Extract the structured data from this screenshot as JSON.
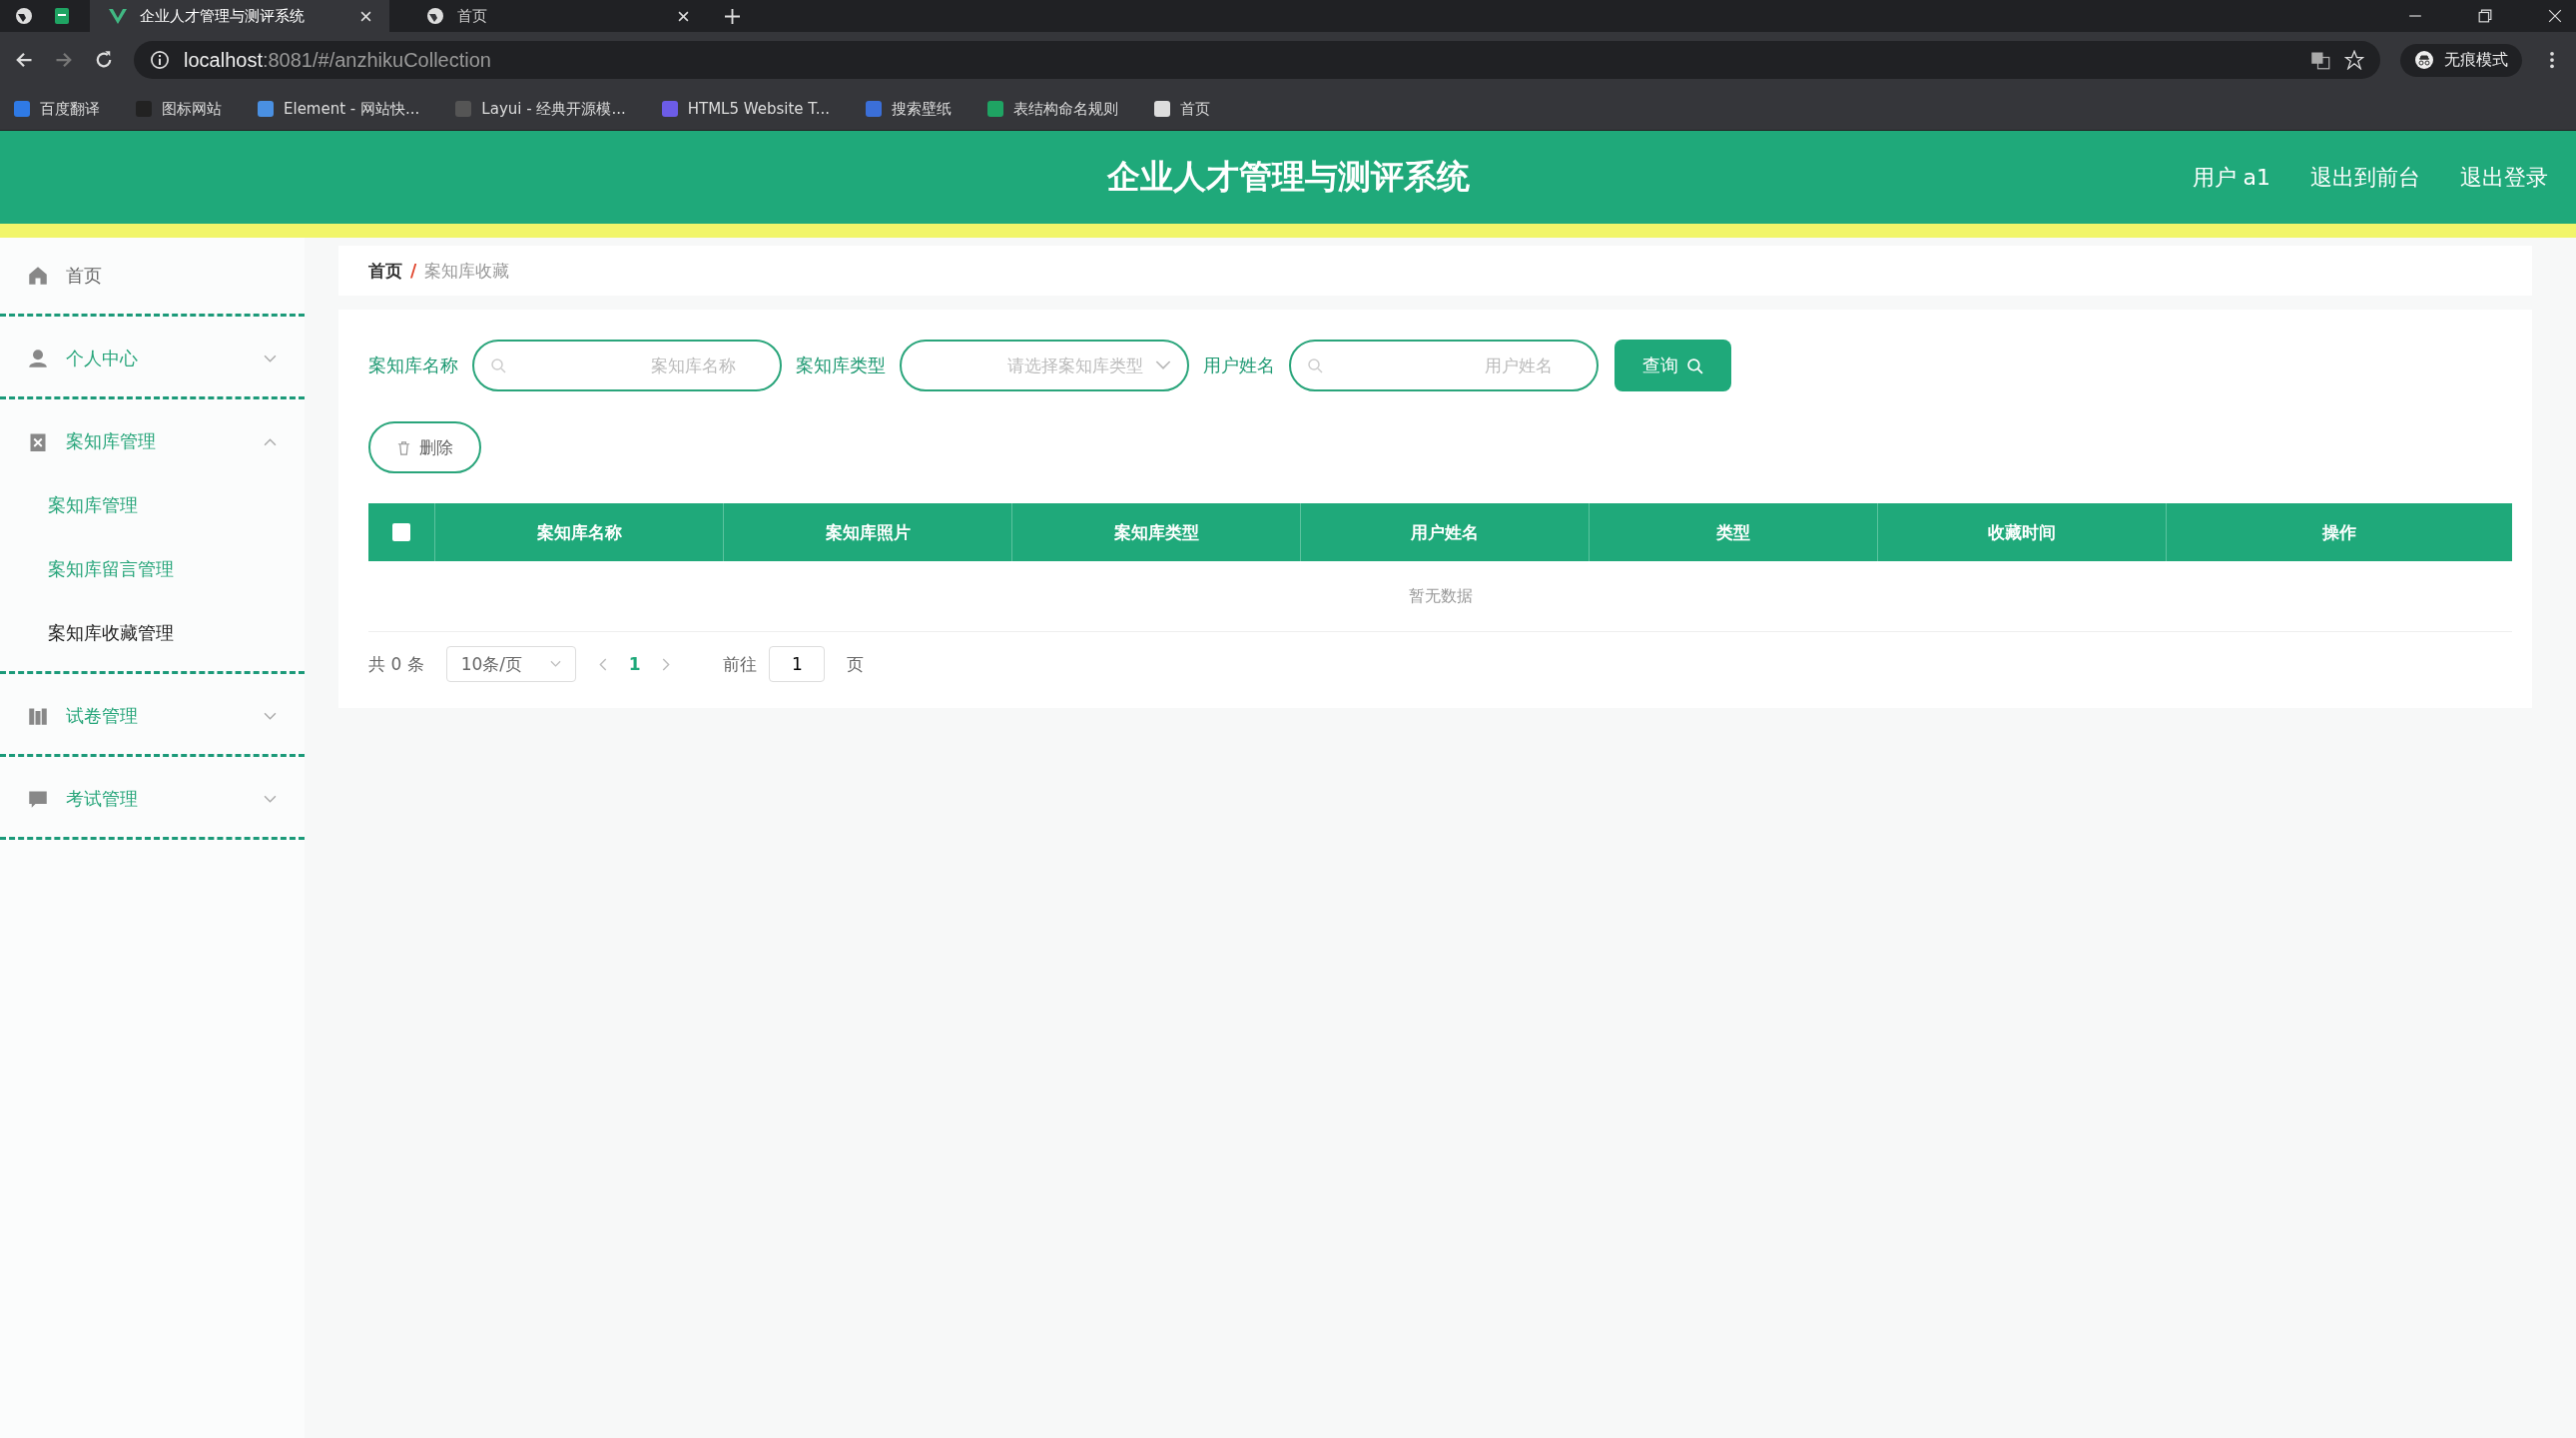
{
  "browser": {
    "tabs": [
      {
        "title": "企业人才管理与测评系统",
        "selected": true,
        "kind": "vue"
      },
      {
        "title": "首页",
        "selected": false,
        "kind": "globe"
      }
    ],
    "url_host": "localhost",
    "url_rest": ":8081/#/anzhikuCollection",
    "profile": "无痕模式",
    "bookmarks": [
      {
        "label": "百度翻译",
        "color": "#2f7ae5"
      },
      {
        "label": "图标网站",
        "color": "#222222"
      },
      {
        "label": "Element - 网站快...",
        "color": "#4a90e2"
      },
      {
        "label": "Layui - 经典开源模...",
        "color": "#555555"
      },
      {
        "label": "HTML5 Website T...",
        "color": "#6c5ce7"
      },
      {
        "label": "搜索壁纸",
        "color": "#3b6fd8"
      },
      {
        "label": "表结构命名规则",
        "color": "#1fa463"
      },
      {
        "label": "首页",
        "color": "#dddddd"
      }
    ]
  },
  "header": {
    "title": "企业人才管理与测评系统",
    "links": [
      "用户 a1",
      "退出到前台",
      "退出登录"
    ]
  },
  "sidebar": {
    "items": [
      {
        "label": "首页"
      },
      {
        "label": "个人中心",
        "expanded": false
      },
      {
        "label": "案知库管理",
        "expanded": true,
        "children": [
          {
            "label": "案知库管理",
            "selected": false
          },
          {
            "label": "案知库留言管理",
            "selected": false
          },
          {
            "label": "案知库收藏管理",
            "selected": true
          }
        ]
      },
      {
        "label": "试卷管理",
        "expanded": false
      },
      {
        "label": "考试管理",
        "expanded": false
      }
    ]
  },
  "breadcrumb": [
    "首页",
    "案知库收藏"
  ],
  "breadcrumb_separator": "/",
  "filters": [
    {
      "label": "案知库名称",
      "placeholder": "案知库名称",
      "kind": "input"
    },
    {
      "label": "案知库类型",
      "placeholder": "请选择案知库类型",
      "kind": "select"
    },
    {
      "label": "用户姓名",
      "placeholder": "用户姓名",
      "kind": "input"
    }
  ],
  "query_button": "查询",
  "delete_button": "删除",
  "table": {
    "select_all_checked": false,
    "columns": [
      "案知库名称",
      "案知库照片",
      "案知库类型",
      "用户姓名",
      "类型",
      "收藏时间",
      "操作"
    ],
    "empty_text": "暂无数据"
  },
  "pagination": {
    "total": "共 0 条",
    "page_size": "10条/页",
    "pages": [
      {
        "label": "1",
        "selected": true
      }
    ],
    "goto_label": "前往",
    "goto_value": "1",
    "page_suffix": "页"
  }
}
